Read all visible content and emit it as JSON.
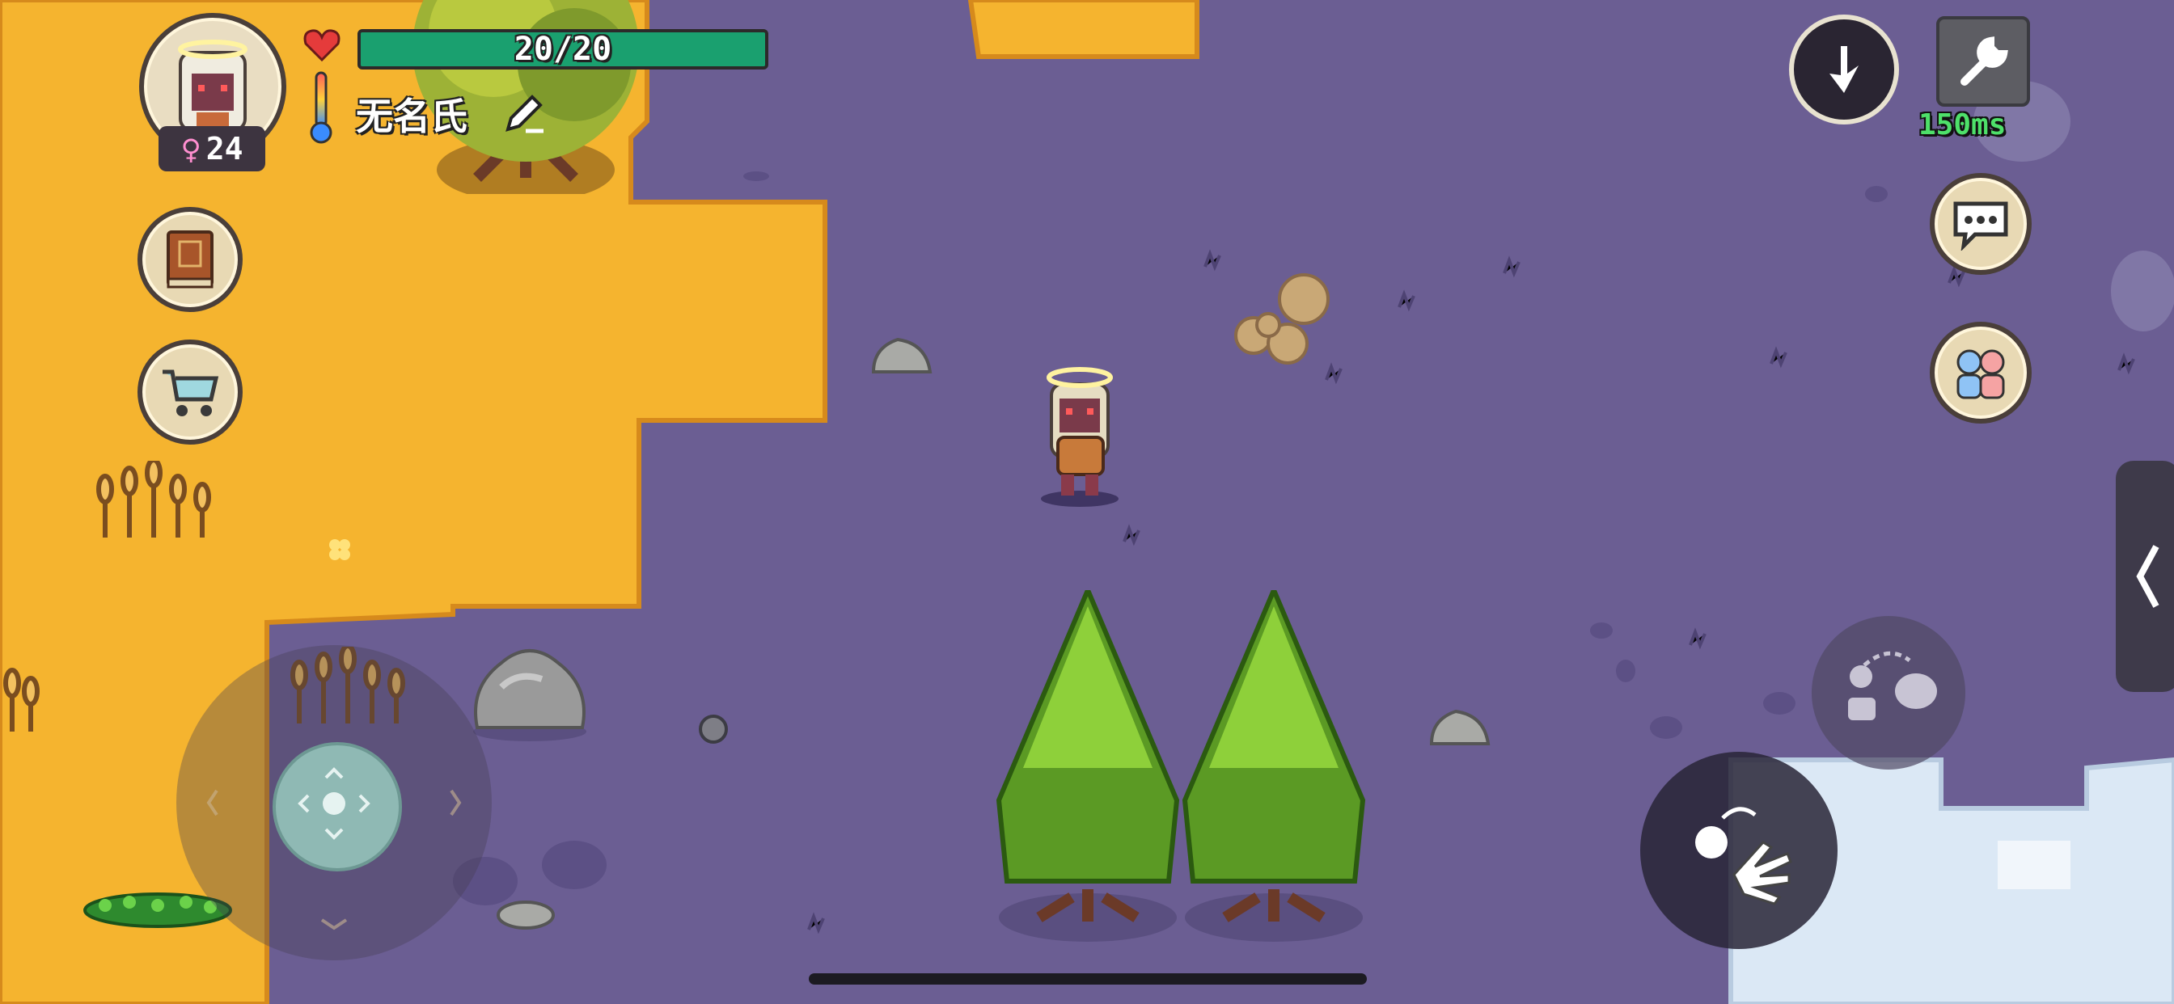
{
  "player": {
    "name": "无名氏",
    "age": "24",
    "gender_symbol": "♀",
    "hp_text": "20/20",
    "hp_fraction": 1.0,
    "avatar_icon": "player-portrait-icon"
  },
  "network": {
    "ping": "150ms"
  },
  "buttons": {
    "edit_name_icon": "pencil-icon",
    "recipe_book_icon": "book-icon",
    "shop_icon": "shopping-cart-icon",
    "drop_icon": "down-arrow-icon",
    "settings_icon": "wrench-icon",
    "chat_icon": "speech-bubble-icon",
    "family_icon": "two-people-icon",
    "side_panel_icon": "chevron-left-icon",
    "interact_icon": "grab-hand-icon",
    "pickup_icon": "swap-hand-icon"
  },
  "colors": {
    "ground_purple": "#6b5e93",
    "desert_yellow": "#f7b731",
    "snow_white": "#dbe8f5",
    "hp_green": "#1aa06f",
    "ping_green": "#4ee06a"
  }
}
